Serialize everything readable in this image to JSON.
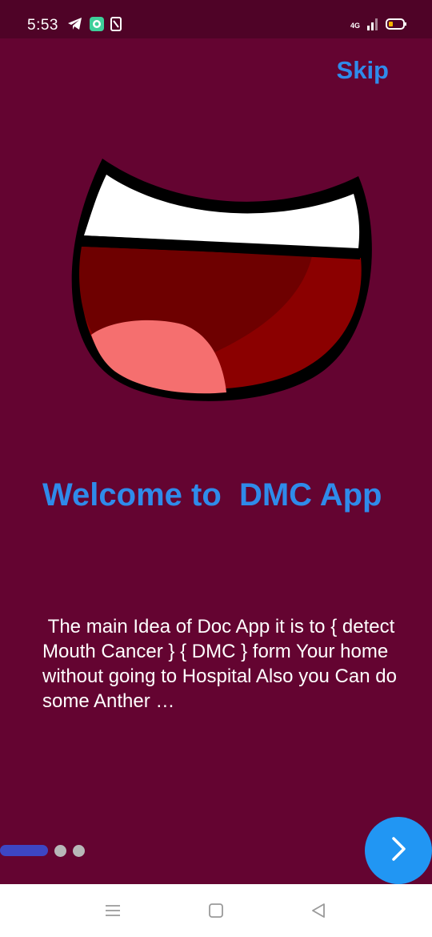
{
  "status_bar": {
    "time": "5:53",
    "network": "4G",
    "icons_left": [
      "telegram-icon",
      "messenger-icon",
      "notification-icon"
    ],
    "icons_right": [
      "signal-icon",
      "battery-icon"
    ]
  },
  "header": {
    "skip_label": "Skip"
  },
  "illustration": {
    "name": "open-mouth-illustration"
  },
  "onboarding": {
    "title": "Welcome to  DMC App",
    "description": " The main Idea of Doc App it is to { detect Mouth Cancer } { DMC } form Your home without going to Hospital Also you Can do some Anther …"
  },
  "pager": {
    "current_page": 1,
    "total_pages": 3
  },
  "next_button": {
    "icon": "chevron-right-icon"
  },
  "colors": {
    "background": "#640431",
    "status_bar": "#4f0327",
    "accent": "#2f8bea",
    "fab": "#2196f3",
    "active_dot": "#3d46c4",
    "inactive_dot": "#b8b8b8"
  },
  "system_nav": {
    "buttons": [
      "menu-icon",
      "home-icon",
      "back-icon"
    ]
  }
}
